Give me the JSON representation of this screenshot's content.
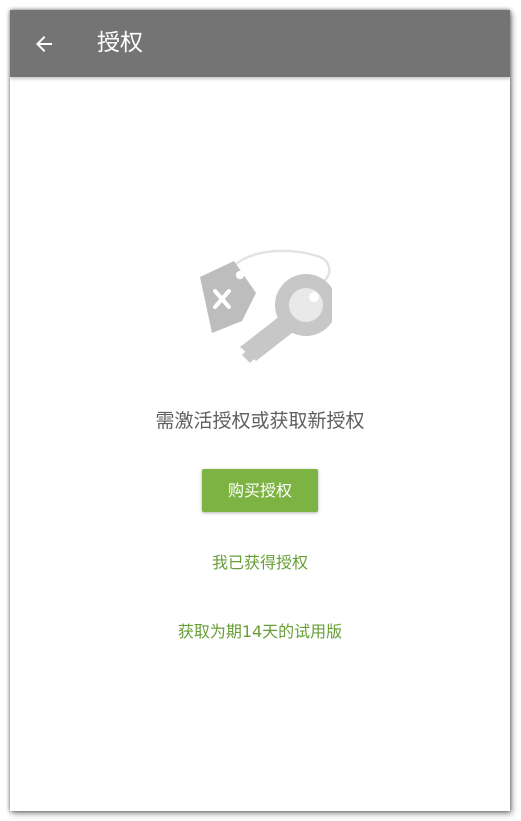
{
  "app_bar": {
    "back_icon": "arrow-back-icon",
    "title": "授权",
    "color": "#747474"
  },
  "illustration": {
    "icon": "license-key-tag-icon"
  },
  "main": {
    "message": "需激活授权或获取新授权",
    "buy_button_label": "购买授权",
    "have_license_link": "我已获得授权",
    "trial_link": "获取为期14天的试用版"
  },
  "colors": {
    "accent": "#7cb342",
    "link": "#689f38",
    "message_text": "#5f5f5f",
    "illustration_gray": "#bdbdbd"
  }
}
